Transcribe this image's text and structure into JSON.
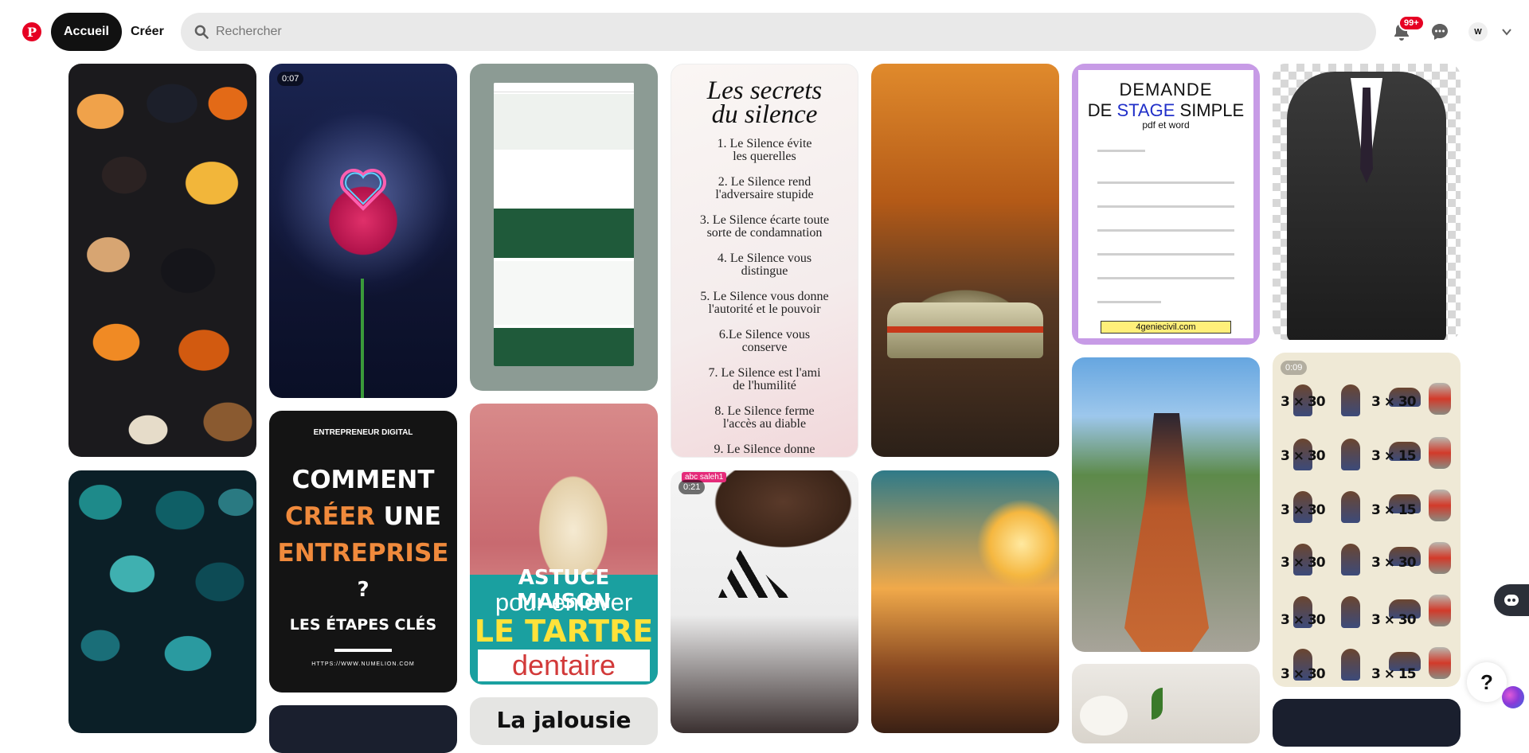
{
  "header": {
    "home_label": "Accueil",
    "create_label": "Créer",
    "search_placeholder": "Rechercher",
    "notification_badge": "99+",
    "avatar_initial": "W",
    "logo_letter": "P",
    "icons": [
      "pinterest-logo",
      "search-icon",
      "bell-icon",
      "message-icon",
      "chevron-down-icon"
    ],
    "accent_color": "#e60023"
  },
  "pins": {
    "rose": {
      "duration": "0:07"
    },
    "secrets": {
      "title_line1": "Les secrets",
      "title_line2": "du silence",
      "items": [
        "1. Le Silence évite",
        "les querelles",
        "2. Le Silence rend",
        "l'adversaire stupide",
        "3. Le Silence écarte toute",
        "sorte de condamnation",
        "4. Le Silence vous",
        "distingue",
        "5. Le Silence vous donne",
        "l'autorité et le pouvoir",
        "6.Le Silence vous",
        "conserve",
        "7. Le Silence est l'ami",
        "de l'humilité",
        "8. Le Silence ferme",
        "l'accès au diable",
        "9. Le Silence donne"
      ]
    },
    "stage": {
      "line1": "DEMANDE",
      "line2_a": "DE ",
      "line2_b": "STAGE",
      "line2_c": " SIMPLE",
      "line3": "pdf et word",
      "url": "4geniecivil.com"
    },
    "entrepreneur": {
      "kicker": "ENTREPRENEUR DIGITAL",
      "line1": "COMMENT",
      "line2_a": "CRÉER",
      "line2_b": " UNE",
      "line3": "ENTREPRISE",
      "line4": "?",
      "line5": "LES ÉTAPES CLÉS",
      "url": "HTTPS://WWW.NUMELION.COM"
    },
    "tooth": {
      "line1": "ASTUCE MAISON",
      "line2": "pour enlever",
      "line3": "LE TARTRE",
      "line4": "dentaire"
    },
    "adidas": {
      "duration": "0:21",
      "user": "abc saleh1"
    },
    "exercise": {
      "duration": "0:09",
      "reps": [
        "3 × 30",
        "3 × 30",
        "3 × 30",
        "3 × 15",
        "3 × 30",
        "3 × 15",
        "3 × 30",
        "3 × 30",
        "3 × 30",
        "3 × 30",
        "3 × 30",
        "3 × 15"
      ]
    },
    "jalousie": {
      "title": "La jalousie"
    }
  },
  "floating": {
    "help_label": "?"
  }
}
